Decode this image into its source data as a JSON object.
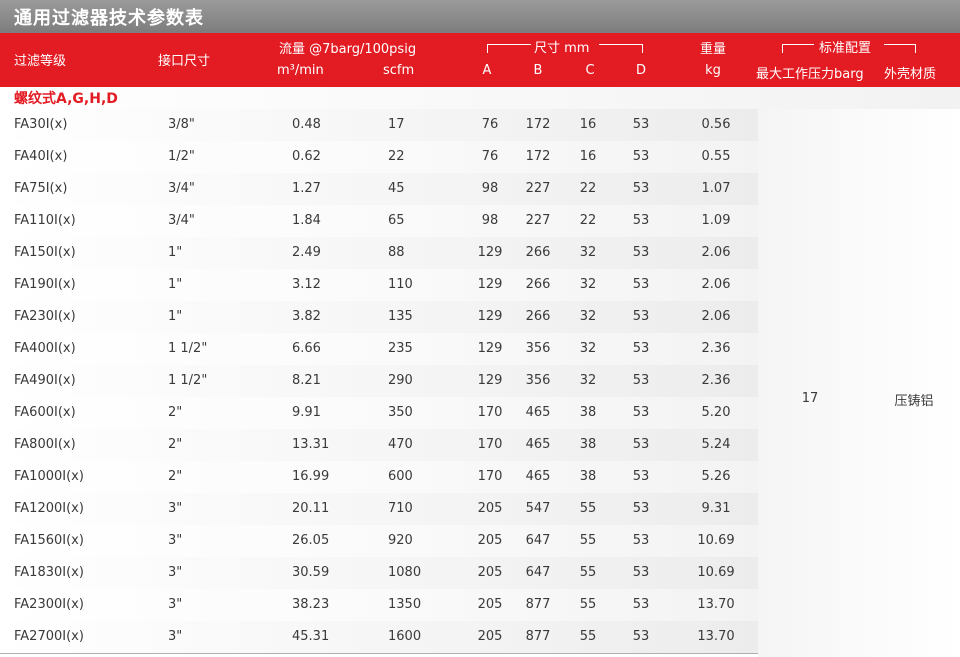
{
  "title": "通用过滤器技术参数表",
  "header": {
    "grade": "过滤等级",
    "port": "接口尺寸",
    "flow": "流量 @7barg/100psig",
    "flow_unit_m3": "m³/min",
    "flow_unit_scfm": "scfm",
    "dims": "尺寸 mm",
    "dim_a": "A",
    "dim_b": "B",
    "dim_c": "C",
    "dim_d": "D",
    "weight": "重量",
    "weight_unit": "kg",
    "standard": "标准配置",
    "max_pressure": "最大工作压力barg",
    "housing": "外壳材质"
  },
  "section_title": "螺纹式A,G,H,D",
  "rows": [
    {
      "model": "FA30I(x)",
      "port": "3/8\"",
      "m3": "0.48",
      "scfm": "17",
      "a": "76",
      "b": "172",
      "c": "16",
      "d": "53",
      "kg": "0.56"
    },
    {
      "model": "FA40I(x)",
      "port": "1/2\"",
      "m3": "0.62",
      "scfm": "22",
      "a": "76",
      "b": "172",
      "c": "16",
      "d": "53",
      "kg": "0.55"
    },
    {
      "model": "FA75I(x)",
      "port": "3/4\"",
      "m3": "1.27",
      "scfm": "45",
      "a": "98",
      "b": "227",
      "c": "22",
      "d": "53",
      "kg": "1.07"
    },
    {
      "model": "FA110I(x)",
      "port": "3/4\"",
      "m3": "1.84",
      "scfm": "65",
      "a": "98",
      "b": "227",
      "c": "22",
      "d": "53",
      "kg": "1.09"
    },
    {
      "model": "FA150I(x)",
      "port": "1\"",
      "m3": "2.49",
      "scfm": "88",
      "a": "129",
      "b": "266",
      "c": "32",
      "d": "53",
      "kg": "2.06"
    },
    {
      "model": "FA190I(x)",
      "port": "1\"",
      "m3": "3.12",
      "scfm": "110",
      "a": "129",
      "b": "266",
      "c": "32",
      "d": "53",
      "kg": "2.06"
    },
    {
      "model": "FA230I(x)",
      "port": "1\"",
      "m3": "3.82",
      "scfm": "135",
      "a": "129",
      "b": "266",
      "c": "32",
      "d": "53",
      "kg": "2.06"
    },
    {
      "model": "FA400I(x)",
      "port": "1 1/2\"",
      "m3": "6.66",
      "scfm": "235",
      "a": "129",
      "b": "356",
      "c": "32",
      "d": "53",
      "kg": "2.36"
    },
    {
      "model": "FA490I(x)",
      "port": "1 1/2\"",
      "m3": "8.21",
      "scfm": "290",
      "a": "129",
      "b": "356",
      "c": "32",
      "d": "53",
      "kg": "2.36"
    },
    {
      "model": "FA600I(x)",
      "port": "2\"",
      "m3": "9.91",
      "scfm": "350",
      "a": "170",
      "b": "465",
      "c": "38",
      "d": "53",
      "kg": "5.20"
    },
    {
      "model": "FA800I(x)",
      "port": "2\"",
      "m3": "13.31",
      "scfm": "470",
      "a": "170",
      "b": "465",
      "c": "38",
      "d": "53",
      "kg": "5.24"
    },
    {
      "model": "FA1000I(x)",
      "port": "2\"",
      "m3": "16.99",
      "scfm": "600",
      "a": "170",
      "b": "465",
      "c": "38",
      "d": "53",
      "kg": "5.26"
    },
    {
      "model": "FA1200I(x)",
      "port": "3\"",
      "m3": "20.11",
      "scfm": "710",
      "a": "205",
      "b": "547",
      "c": "55",
      "d": "53",
      "kg": "9.31"
    },
    {
      "model": "FA1560I(x)",
      "port": "3\"",
      "m3": "26.05",
      "scfm": "920",
      "a": "205",
      "b": "647",
      "c": "55",
      "d": "53",
      "kg": "10.69"
    },
    {
      "model": "FA1830I(x)",
      "port": "3\"",
      "m3": "30.59",
      "scfm": "1080",
      "a": "205",
      "b": "647",
      "c": "55",
      "d": "53",
      "kg": "10.69"
    },
    {
      "model": "FA2300I(x)",
      "port": "3\"",
      "m3": "38.23",
      "scfm": "1350",
      "a": "205",
      "b": "877",
      "c": "55",
      "d": "53",
      "kg": "13.70"
    },
    {
      "model": "FA2700I(x)",
      "port": "3\"",
      "m3": "45.31",
      "scfm": "1600",
      "a": "205",
      "b": "877",
      "c": "55",
      "d": "53",
      "kg": "13.70"
    }
  ],
  "merged": {
    "max_pressure_value": "17",
    "housing_value": "压铸铝"
  }
}
